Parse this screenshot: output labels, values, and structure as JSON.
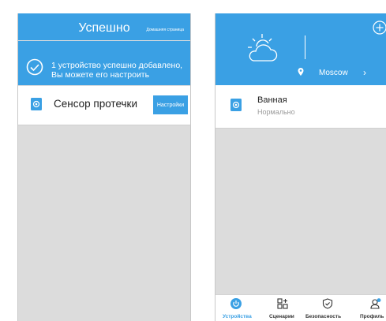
{
  "left_screen": {
    "title": "Успешно",
    "home_link": "Домашняя страница",
    "banner": {
      "line1": "1 устройство успешно добавлено,",
      "line2": "Вы можете его настроить"
    },
    "device": {
      "name": "Сенсор протечки",
      "settings_label": "Настройки"
    }
  },
  "right_screen": {
    "location": "Moscow",
    "room": {
      "name": "Ванная",
      "status": "Нормально"
    },
    "tabs": [
      {
        "label": "Устройства",
        "icon": "power-icon",
        "active": true
      },
      {
        "label": "Сценарии",
        "icon": "scenes-icon",
        "active": false
      },
      {
        "label": "Безопасность",
        "icon": "shield-icon",
        "active": false
      },
      {
        "label": "Профиль",
        "icon": "profile-icon",
        "active": false
      }
    ]
  },
  "colors": {
    "accent": "#3aa0e4",
    "background": "#dcdcdc",
    "notification_dot": "#3aa0e4"
  }
}
